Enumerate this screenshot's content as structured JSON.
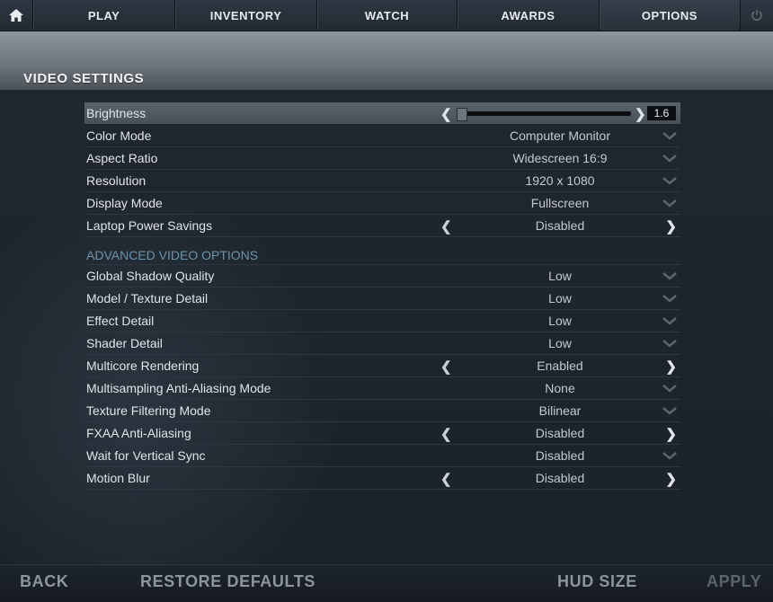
{
  "nav": {
    "home_icon": "home-icon",
    "power_icon": "power-icon",
    "tabs": [
      {
        "label": "PLAY"
      },
      {
        "label": "INVENTORY"
      },
      {
        "label": "WATCH"
      },
      {
        "label": "AWARDS"
      },
      {
        "label": "OPTIONS"
      }
    ]
  },
  "page": {
    "title": "VIDEO SETTINGS"
  },
  "settings": {
    "brightness": {
      "label": "Brightness",
      "value": "1.6",
      "level": 0.0
    },
    "basic": [
      {
        "label": "Color Mode",
        "value": "Computer Monitor",
        "control": "dropdown"
      },
      {
        "label": "Aspect Ratio",
        "value": "Widescreen 16:9",
        "control": "dropdown"
      },
      {
        "label": "Resolution",
        "value": "1920 x 1080",
        "control": "dropdown"
      },
      {
        "label": "Display Mode",
        "value": "Fullscreen",
        "control": "dropdown"
      },
      {
        "label": "Laptop Power Savings",
        "value": "Disabled",
        "control": "toggle"
      }
    ],
    "advanced_heading": "ADVANCED VIDEO OPTIONS",
    "advanced": [
      {
        "label": "Global Shadow Quality",
        "value": "Low",
        "control": "dropdown"
      },
      {
        "label": "Model / Texture Detail",
        "value": "Low",
        "control": "dropdown"
      },
      {
        "label": "Effect Detail",
        "value": "Low",
        "control": "dropdown"
      },
      {
        "label": "Shader Detail",
        "value": "Low",
        "control": "dropdown"
      },
      {
        "label": "Multicore Rendering",
        "value": "Enabled",
        "control": "toggle"
      },
      {
        "label": "Multisampling Anti-Aliasing Mode",
        "value": "None",
        "control": "dropdown"
      },
      {
        "label": "Texture Filtering Mode",
        "value": "Bilinear",
        "control": "dropdown"
      },
      {
        "label": "FXAA Anti-Aliasing",
        "value": "Disabled",
        "control": "toggle"
      },
      {
        "label": "Wait for Vertical Sync",
        "value": "Disabled",
        "control": "dropdown"
      },
      {
        "label": "Motion Blur",
        "value": "Disabled",
        "control": "toggle"
      }
    ]
  },
  "bottom": {
    "back": "BACK",
    "restore": "RESTORE DEFAULTS",
    "hud_size": "HUD SIZE",
    "apply": "APPLY"
  }
}
